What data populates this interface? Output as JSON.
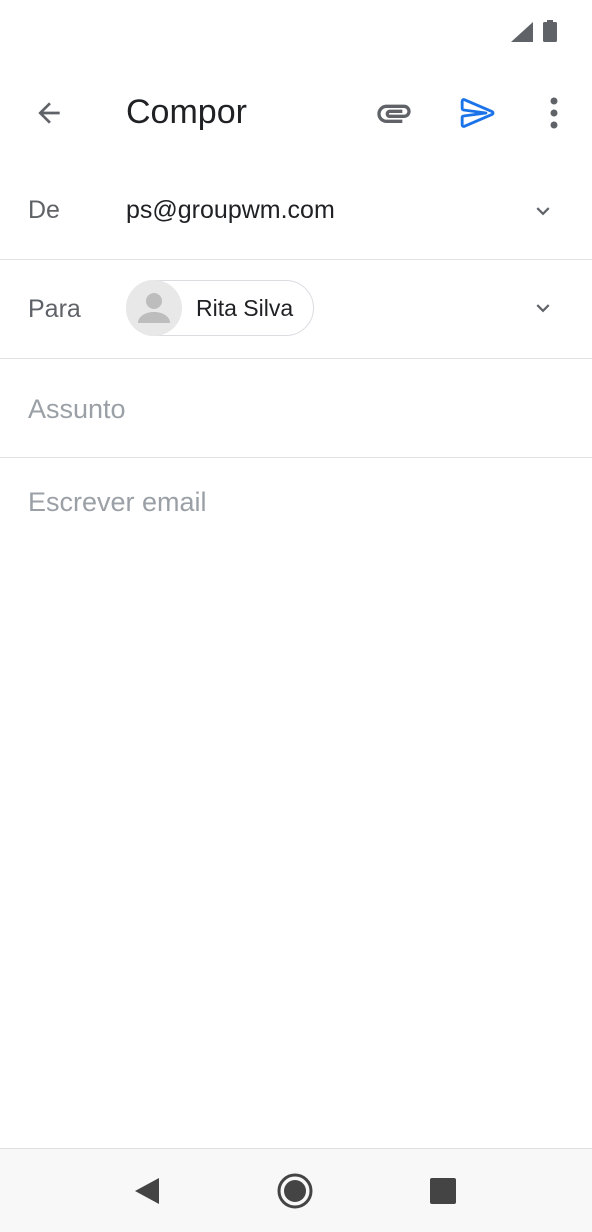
{
  "status_bar": {
    "signal_icon": "cell-signal-icon",
    "battery_icon": "battery-icon"
  },
  "app_bar": {
    "title": "Compor",
    "back_icon": "arrow-back-icon",
    "attach_icon": "paperclip-icon",
    "send_icon": "send-icon",
    "more_icon": "more-vert-icon"
  },
  "form": {
    "from_label": "De",
    "from_value": "ps@groupwm.com",
    "to_label": "Para",
    "to_chip_label": "Rita Silva",
    "subject_placeholder": "Assunto",
    "subject_value": "",
    "body_placeholder": "Escrever email",
    "body_value": ""
  },
  "nav_bar": {
    "back_icon": "nav-back-triangle-icon",
    "home_icon": "nav-home-circle-icon",
    "recents_icon": "nav-recents-square-icon"
  },
  "colors": {
    "accent": "#1a73e8",
    "icon_grey": "#5f6368",
    "placeholder": "#9aa0a6",
    "divider": "#e3e3e3"
  }
}
